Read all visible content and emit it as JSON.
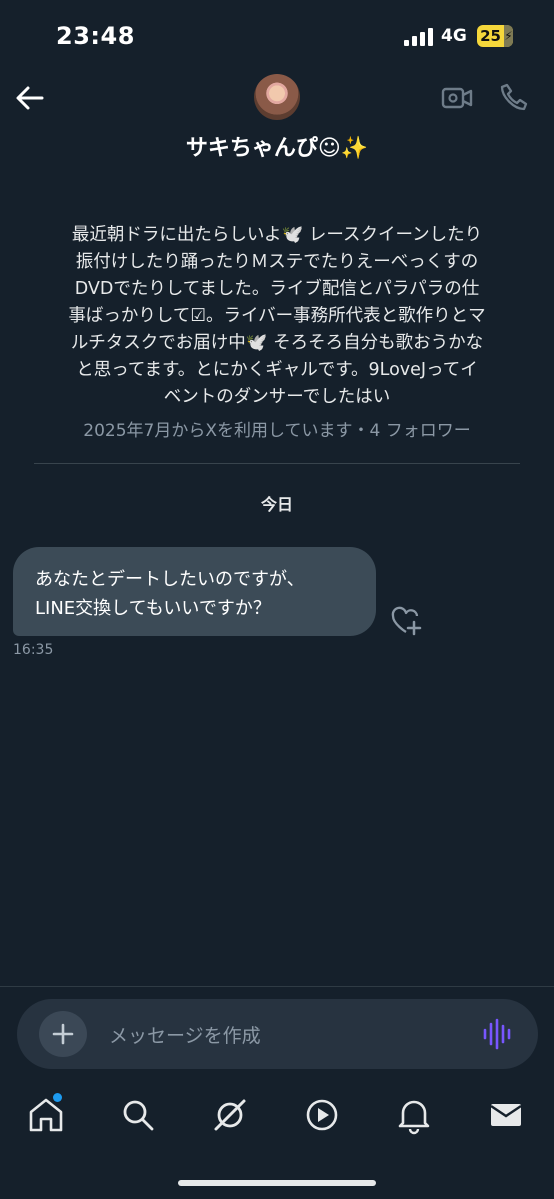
{
  "status_bar": {
    "time": "23:48",
    "network": "4G",
    "battery": "25",
    "battery_icon": "charging-bolt"
  },
  "header": {
    "contact_name": "サキちゃんぴ☺✨",
    "back_icon": "back-arrow-icon",
    "video_icon": "video-call-icon",
    "phone_icon": "phone-icon"
  },
  "profile": {
    "bio": "最近朝ドラに出たらしいよ🕊️ レースクイーンしたり\n振付けしたり踊ったりＭステでたりえーべっくすの\nDVDでたりしてました。ライブ配信とパラパラの仕\n事ばっかりして☑。ライバー事務所代表と歌作りとマ\nルチタスクでお届け中🕊️ そろそろ自分も歌おうかな\nと思ってます。とにかくギャルです。9LoveJってイ\nベントのダンサーでしたはい",
    "meta": "2025年7月からXを利用しています・4 フォロワー"
  },
  "conversation": {
    "day_label": "今日",
    "messages": [
      {
        "text": "あなたとデートしたいのですが、\nLINE交換してもいいですか？",
        "time": "16:35"
      }
    ]
  },
  "composer": {
    "placeholder": "メッセージを作成"
  },
  "tabs": [
    {
      "icon": "home-icon",
      "has_badge": true
    },
    {
      "icon": "search-icon"
    },
    {
      "icon": "grok-icon"
    },
    {
      "icon": "video-play-icon"
    },
    {
      "icon": "notifications-bell-icon"
    },
    {
      "icon": "messages-envelope-icon"
    }
  ],
  "colors": {
    "background": "#15202b",
    "bubble": "#3c4b57",
    "accent": "#1d9bf0",
    "voice": "#7856ff"
  }
}
